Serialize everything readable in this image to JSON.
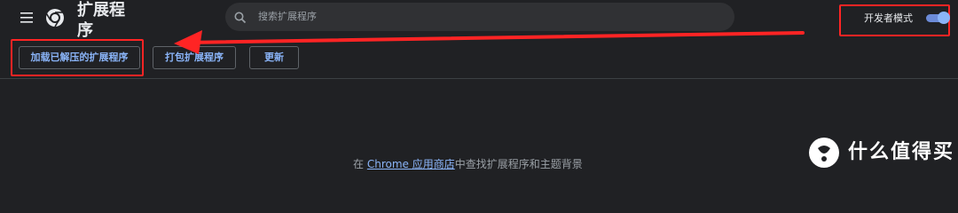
{
  "header": {
    "title": "扩展程序",
    "menu_icon": "hamburger-menu-icon",
    "app_icon": "chrome-icon"
  },
  "search": {
    "placeholder": "搜索扩展程序"
  },
  "developer_mode": {
    "label": "开发者模式",
    "enabled": true
  },
  "toolbar": {
    "load_unpacked_label": "加载已解压的扩展程序",
    "pack_label": "打包扩展程序",
    "update_label": "更新"
  },
  "main": {
    "hint_prefix": "在 ",
    "hint_link": "Chrome 应用商店",
    "hint_suffix": "中查找扩展程序和主题背景"
  },
  "watermark": {
    "text": "什么值得买"
  },
  "annotation": {
    "highlight_color": "#ff2424"
  },
  "colors": {
    "background": "#202124",
    "accent": "#8ab4f8",
    "annotation_red": "#ff2424"
  }
}
